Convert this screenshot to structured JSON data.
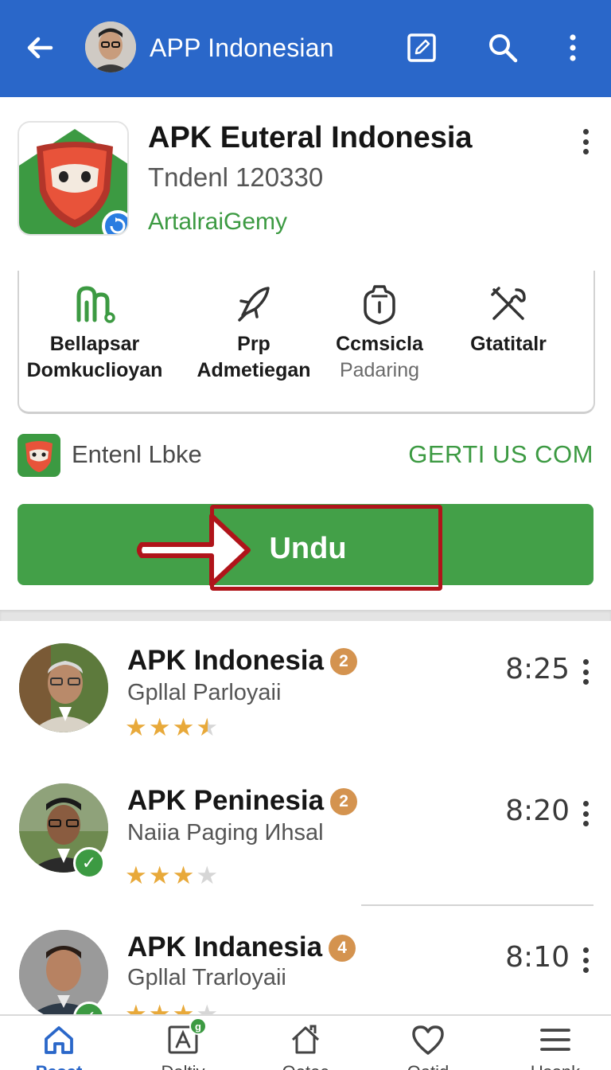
{
  "topbar": {
    "title": "APP Indonesian",
    "back_icon": "arrow-left-icon",
    "edit_icon": "edit-square-icon",
    "search_icon": "search-icon",
    "more_icon": "more-vertical-icon",
    "background_color": "#2a67c9"
  },
  "app": {
    "name": "APK Euteral Indonesia",
    "subtitle": "Tndenl 120330",
    "developer": "ArtalraiGemy",
    "developer_color": "#3c9a42"
  },
  "features": [
    {
      "icon": "chart-bars-icon",
      "line1": "Bellapsar",
      "line2": "Domkucliоyan"
    },
    {
      "icon": "rocket-icon",
      "line1": "Prp",
      "line2": "Admetiegan"
    },
    {
      "icon": "shield-lock-icon",
      "line1": "Ccmsicla",
      "line2": "Padaring"
    },
    {
      "icon": "tools-icon",
      "line1": "Gtatitalr",
      "line2": ""
    }
  ],
  "link_row": {
    "label": "Entenl Lbke",
    "action": "GERTI US COM"
  },
  "install_button": {
    "label": "Undu",
    "color": "#43a048",
    "highlight_color": "#b0141a"
  },
  "list": [
    {
      "name": "APK Indonesia",
      "badge": "2",
      "desc": "Gpllal Parloyaii",
      "time": "8:25",
      "stars": "★★★",
      "half": "★",
      "verified": false,
      "rating": 3.5
    },
    {
      "name": "APK Peninesia",
      "badge": "2",
      "desc": "Naiia Paging Иhsal",
      "time": "8:20",
      "stars": "★★★",
      "half": "★",
      "verified": true,
      "rating": 3
    },
    {
      "name": "APK Indanesia",
      "badge": "4",
      "desc": "Gpllal Trarloyaii",
      "time": "8:10",
      "stars": "★★★",
      "half": "★",
      "verified": true,
      "rating": 3.5
    }
  ],
  "bottom_nav": [
    {
      "icon": "home-icon",
      "label": "Pesat"
    },
    {
      "icon": "apps-icon",
      "label": "Daltiv",
      "badge": "g"
    },
    {
      "icon": "house-outline-icon",
      "label": "Oetec"
    },
    {
      "icon": "heart-icon",
      "label": "Oatid"
    },
    {
      "icon": "menu-icon",
      "label": "Usonk"
    }
  ]
}
